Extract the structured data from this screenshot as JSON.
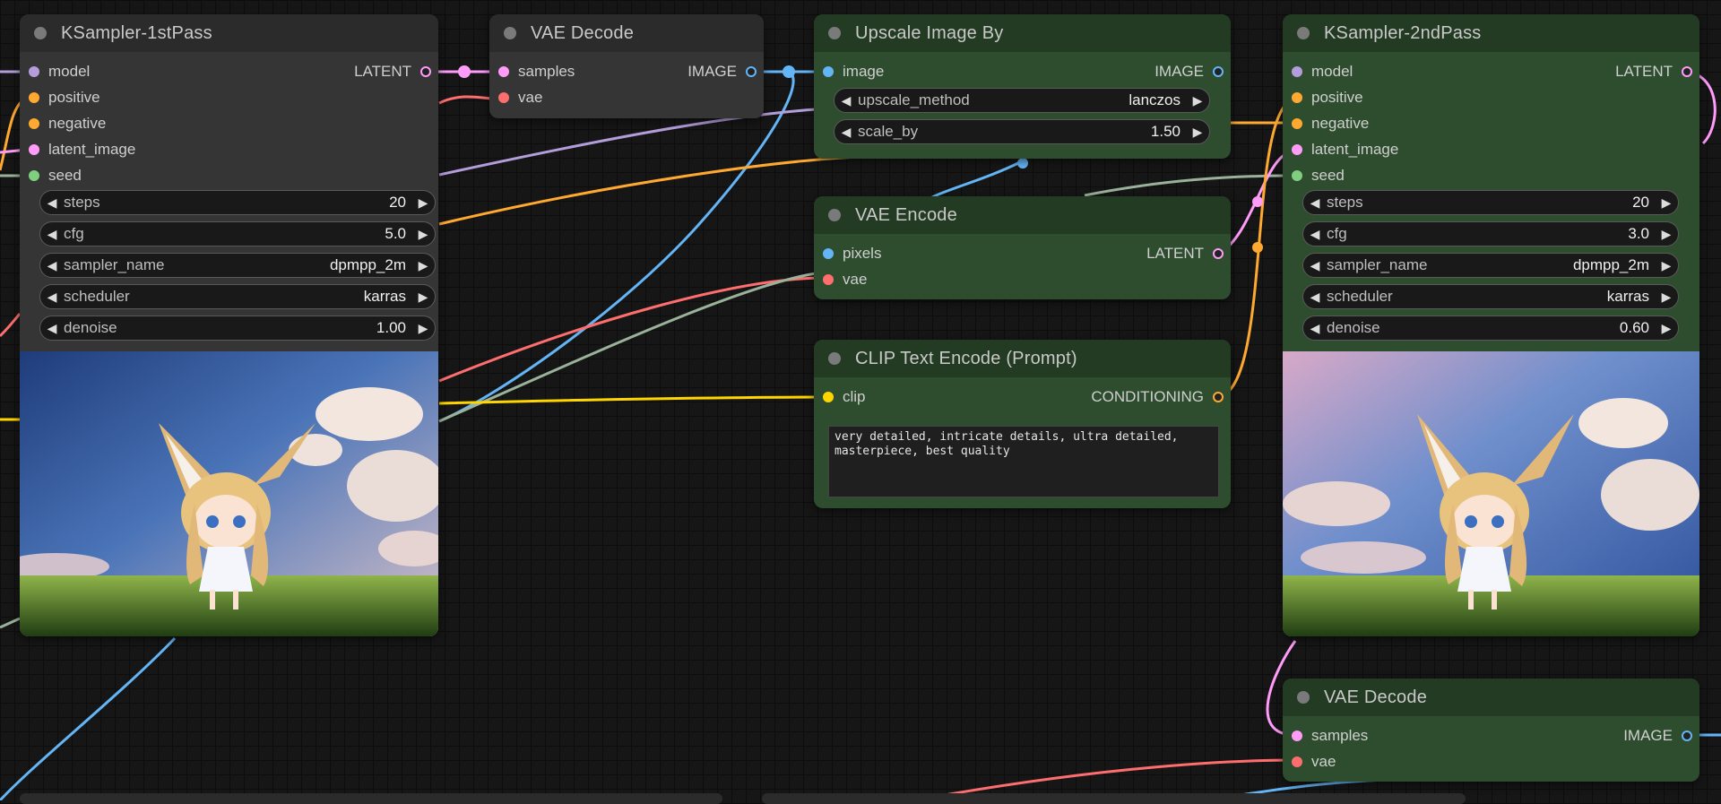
{
  "nodes": {
    "ksampler1": {
      "title": "KSampler-1stPass",
      "inputs": [
        "model",
        "positive",
        "negative",
        "latent_image",
        "seed"
      ],
      "output": "LATENT",
      "widgets": [
        {
          "label": "steps",
          "value": "20"
        },
        {
          "label": "cfg",
          "value": "5.0"
        },
        {
          "label": "sampler_name",
          "value": "dpmpp_2m"
        },
        {
          "label": "scheduler",
          "value": "karras"
        },
        {
          "label": "denoise",
          "value": "1.00"
        }
      ]
    },
    "vaedecode1": {
      "title": "VAE Decode",
      "inputs": [
        "samples",
        "vae"
      ],
      "output": "IMAGE"
    },
    "upscale": {
      "title": "Upscale Image By",
      "inputs": [
        "image"
      ],
      "output": "IMAGE",
      "widgets": [
        {
          "label": "upscale_method",
          "value": "lanczos"
        },
        {
          "label": "scale_by",
          "value": "1.50"
        }
      ]
    },
    "vaeencode": {
      "title": "VAE Encode",
      "inputs": [
        "pixels",
        "vae"
      ],
      "output": "LATENT"
    },
    "clip": {
      "title": "CLIP Text Encode (Prompt)",
      "inputs": [
        "clip"
      ],
      "output": "CONDITIONING",
      "text": "very detailed, intricate details, ultra detailed,\nmasterpiece, best quality"
    },
    "ksampler2": {
      "title": "KSampler-2ndPass",
      "inputs": [
        "model",
        "positive",
        "negative",
        "latent_image",
        "seed"
      ],
      "output": "LATENT",
      "widgets": [
        {
          "label": "steps",
          "value": "20"
        },
        {
          "label": "cfg",
          "value": "3.0"
        },
        {
          "label": "sampler_name",
          "value": "dpmpp_2m"
        },
        {
          "label": "scheduler",
          "value": "karras"
        },
        {
          "label": "denoise",
          "value": "0.60"
        }
      ]
    },
    "vaedecode2": {
      "title": "VAE Decode",
      "inputs": [
        "samples",
        "vae"
      ],
      "output": "IMAGE"
    }
  },
  "socket_colors": {
    "model": "#b39ddb",
    "positive": "#ffa931",
    "negative": "#ffa931",
    "latent_image": "#ff9cf9",
    "seed": "#7ed07e",
    "samples": "#ff9cf9",
    "vae": "#ff6e6e",
    "image": "#64b5f6",
    "pixels": "#64b5f6",
    "clip": "#ffd500",
    "LATENT": "#ff9cf9",
    "IMAGE": "#64b5f6",
    "CONDITIONING": "#ffa931"
  },
  "icons": {
    "widget_left": "triangle-left-icon",
    "widget_right": "triangle-right-icon",
    "node_collapse": "dot-icon"
  }
}
